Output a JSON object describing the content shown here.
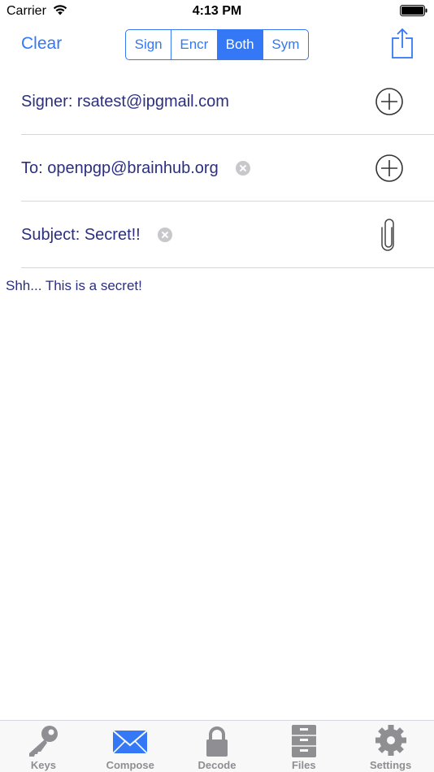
{
  "status_bar": {
    "carrier": "Carrier",
    "time": "4:13 PM"
  },
  "nav": {
    "clear_label": "Clear",
    "segments": [
      "Sign",
      "Encr",
      "Both",
      "Sym"
    ],
    "selected_segment": "Both"
  },
  "fields": {
    "signer": "Signer: rsatest@ipgmail.com",
    "to": "To: openpgp@brainhub.org",
    "subject": "Subject: Secret!!"
  },
  "message_body": "Shh... This is a secret!",
  "tabs": [
    {
      "label": "Keys",
      "icon": "key-icon"
    },
    {
      "label": "Compose",
      "icon": "envelope-icon"
    },
    {
      "label": "Decode",
      "icon": "lock-icon"
    },
    {
      "label": "Files",
      "icon": "file-cabinet-icon"
    },
    {
      "label": "Settings",
      "icon": "gear-icon"
    }
  ],
  "active_tab": "Compose",
  "colors": {
    "accent": "#3478f6",
    "text": "#2c2f80",
    "tab_inactive": "#8e8e93"
  }
}
